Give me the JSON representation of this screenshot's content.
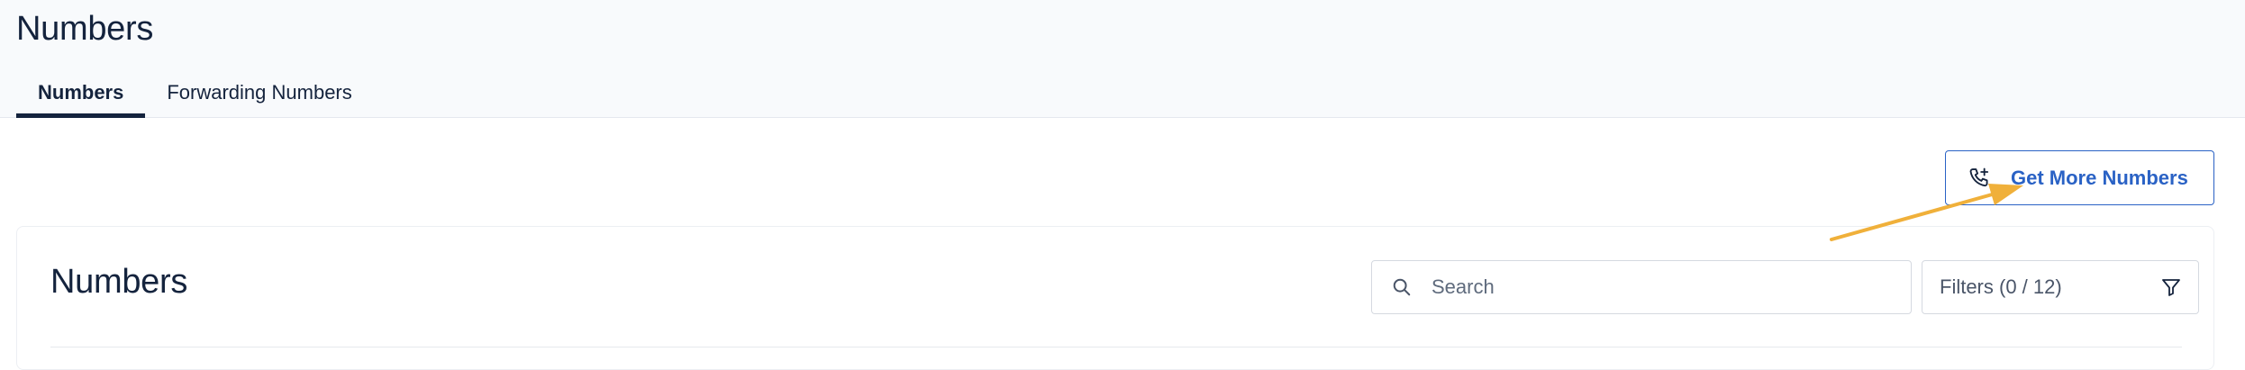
{
  "header": {
    "title": "Numbers",
    "tabs": [
      {
        "label": "Numbers",
        "active": true
      },
      {
        "label": "Forwarding Numbers",
        "active": false
      }
    ]
  },
  "actions": {
    "get_more_label": "Get More Numbers",
    "get_more_icon": "phone-plus-icon"
  },
  "card": {
    "title": "Numbers",
    "search": {
      "placeholder": "Search",
      "value": ""
    },
    "filters": {
      "label": "Filters (0 / 12)",
      "icon": "filter-icon"
    }
  },
  "colors": {
    "accent": "#2a62c5",
    "text_primary": "#14233d",
    "annotation": "#f0b03a",
    "header_bg": "#f8fafc"
  }
}
